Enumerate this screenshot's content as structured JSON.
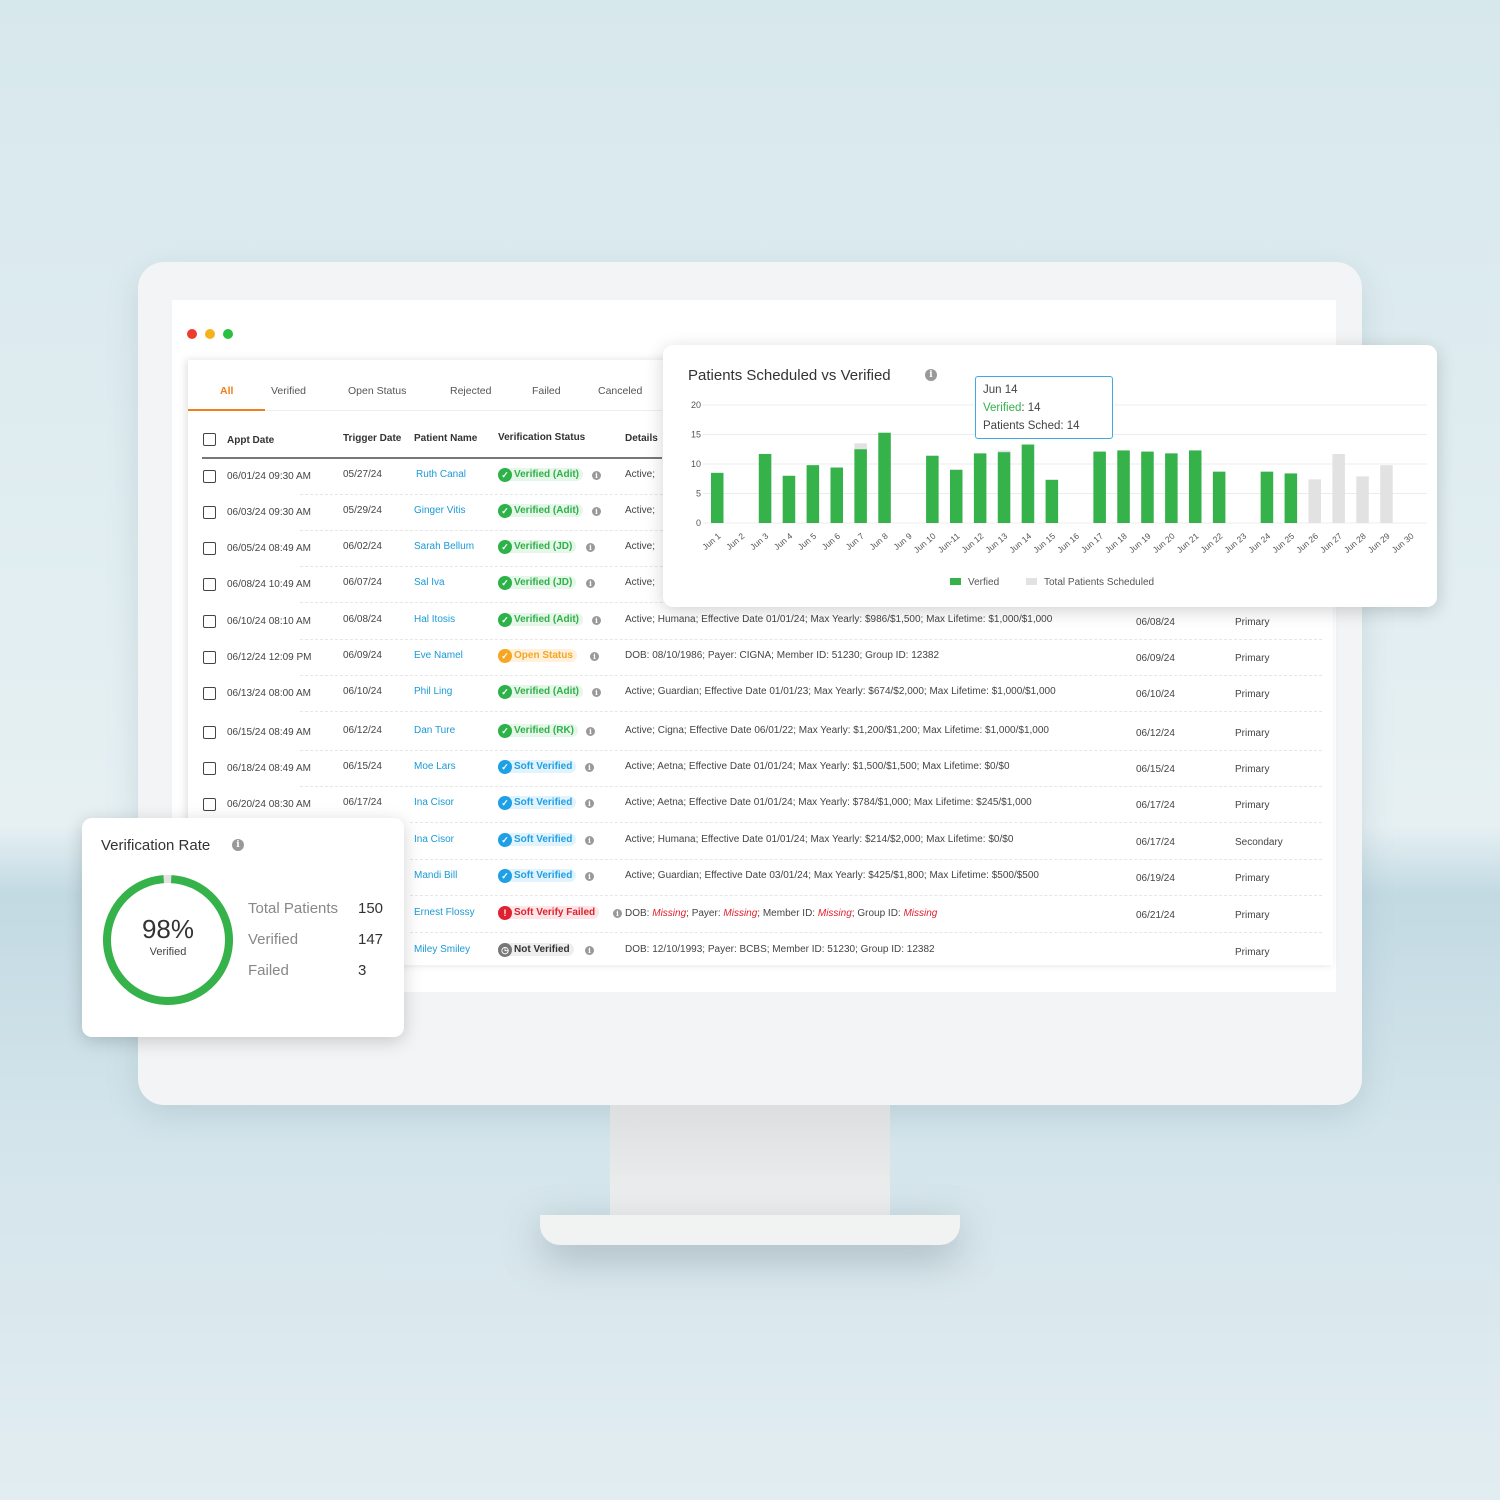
{
  "window": {
    "controls": [
      "close",
      "minimize",
      "maximize"
    ],
    "colors": {
      "close": "#ee3b2f",
      "minimize": "#f6b21b",
      "maximize": "#28c03d"
    }
  },
  "tabs": [
    {
      "label": "All",
      "active": true
    },
    {
      "label": "Verified"
    },
    {
      "label": "Open Status"
    },
    {
      "label": "Rejected"
    },
    {
      "label": "Failed"
    },
    {
      "label": "Canceled"
    }
  ],
  "table": {
    "headers": {
      "appt_date": "Appt Date",
      "trigger_date": "Trigger Date",
      "patient_name": "Patient Name",
      "status": "Verification Status",
      "details": "Details"
    },
    "rows": [
      {
        "appt": "06/01/24 09:30 AM",
        "trigger": "05/27/24",
        "name": "Ruth Canal",
        "status": "Verified (Adit)",
        "kind": "verified",
        "details": "Active;",
        "date": "",
        "type": ""
      },
      {
        "appt": "06/03/24 09:30 AM",
        "trigger": "05/29/24",
        "name": "Ginger Vitis",
        "status": "Verified (Adit)",
        "kind": "verified",
        "details": "Active;",
        "date": "",
        "type": ""
      },
      {
        "appt": "06/05/24 08:49 AM",
        "trigger": "06/02/24",
        "name": "Sarah Bellum",
        "status": "Verified (JD)",
        "kind": "verified",
        "details": "Active;",
        "date": "",
        "type": ""
      },
      {
        "appt": "06/08/24 10:49 AM",
        "trigger": "06/07/24",
        "name": "Sal Iva",
        "status": "Verified (JD)",
        "kind": "verified",
        "details": "Active;",
        "date": "",
        "type": ""
      },
      {
        "appt": "06/10/24 08:10 AM",
        "trigger": "06/08/24",
        "name": "Hal Itosis",
        "status": "Verified (Adit)",
        "kind": "verified",
        "details": "Active; Humana; Effective Date 01/01/24; Max Yearly: $986/$1,500; Max Lifetime: $1,000/$1,000",
        "date": "06/08/24",
        "type": "Primary"
      },
      {
        "appt": "06/12/24 12:09 PM",
        "trigger": "06/09/24",
        "name": "Eve Namel",
        "status": "Open Status",
        "kind": "open",
        "details": "DOB: 08/10/1986; Payer: CIGNA; Member ID: 51230; Group ID: 12382",
        "date": "06/09/24",
        "type": "Primary"
      },
      {
        "appt": "06/13/24 08:00 AM",
        "trigger": "06/10/24",
        "name": "Phil Ling",
        "status": "Verified (Adit)",
        "kind": "verified",
        "details": "Active; Guardian; Effective Date 01/01/23; Max Yearly: $674/$2,000; Max Lifetime: $1,000/$1,000",
        "date": "06/10/24",
        "type": "Primary"
      },
      {
        "appt": "06/15/24 08:49 AM",
        "trigger": "06/12/24",
        "name": "Dan Ture",
        "status": "Verified (RK)",
        "kind": "verified",
        "details": "Active; Cigna; Effective Date 06/01/22; Max Yearly: $1,200/$1,200; Max Lifetime: $1,000/$1,000",
        "date": "06/12/24",
        "type": "Primary"
      },
      {
        "appt": "06/18/24 08:49 AM",
        "trigger": "06/15/24",
        "name": "Moe Lars",
        "status": "Soft Verified",
        "kind": "soft",
        "details": "Active; Aetna; Effective Date 01/01/24; Max Yearly: $1,500/$1,500; Max Lifetime: $0/$0",
        "date": "06/15/24",
        "type": "Primary"
      },
      {
        "appt": "06/20/24 08:30 AM",
        "trigger": "06/17/24",
        "name": "Ina Cisor",
        "status": "Soft Verified",
        "kind": "soft",
        "details": "Active; Aetna; Effective Date 01/01/24; Max Yearly: $784/$1,000; Max Lifetime: $245/$1,000",
        "date": "06/17/24",
        "type": "Primary"
      },
      {
        "appt": "",
        "trigger": "",
        "name": "Ina Cisor",
        "status": "Soft Verified",
        "kind": "soft",
        "details": "Active; Humana; Effective Date 01/01/24; Max Yearly: $214/$2,000; Max Lifetime: $0/$0",
        "date": "06/17/24",
        "type": "Secondary"
      },
      {
        "appt": "",
        "trigger": "",
        "name": "Mandi Bill",
        "status": "Soft Verified",
        "kind": "soft",
        "details": "Active; Guardian; Effective Date 03/01/24; Max Yearly: $425/$1,800; Max Lifetime: $500/$500",
        "date": "06/19/24",
        "type": "Primary"
      },
      {
        "appt": "",
        "trigger": "",
        "name": "Ernest Flossy",
        "status": "Soft Verify Failed",
        "kind": "failed",
        "details_parts": [
          "DOB: ",
          "Missing",
          "; Payer: ",
          "Missing",
          "; Member ID: ",
          "Missing",
          "; Group ID: ",
          "Missing"
        ],
        "date": "06/21/24",
        "type": "Primary"
      },
      {
        "appt": "",
        "trigger": "",
        "name": "Miley Smiley",
        "status": "Not Verified",
        "kind": "not",
        "details": "DOB: 12/10/1993; Payer: BCBS; Member ID: 51230; Group ID: 12382",
        "date": "",
        "type": "Primary"
      }
    ]
  },
  "status_colors": {
    "verified": "#2db24a",
    "open": "#f5a623",
    "soft": "#1ea0e6",
    "failed": "#e0212f",
    "not": "#777777"
  },
  "chart_data": {
    "type": "bar",
    "title": "Patients Scheduled vs Verified",
    "categories": [
      "Jun 1",
      "Jun 2",
      "Jun 3",
      "Jun 4",
      "Jun 5",
      "Jun 6",
      "Jun 7",
      "Jun 8",
      "Jun 9",
      "Jun 10",
      "Jun-11",
      "Jun 12",
      "Jun 13",
      "Jun 14",
      "Jun 15",
      "Jun 16",
      "Jun 17",
      "Jun 18",
      "Jun 19",
      "Jun 20",
      "Jun 21",
      "Jun 22",
      "Jun 23",
      "Jun 24",
      "Jun 25",
      "Jun 26",
      "Jun 27",
      "Jun 28",
      "Jun 29",
      "Jun 30"
    ],
    "series": [
      {
        "name": "Verfied",
        "color": "#36b24a",
        "values": [
          8.5,
          0,
          11.7,
          8,
          9.8,
          9.4,
          12.5,
          15.3,
          0,
          11.4,
          9,
          11.8,
          12,
          13.3,
          7.3,
          0,
          12.1,
          12.3,
          12.1,
          11.8,
          12.3,
          8.7,
          0,
          8.7,
          8.4,
          0,
          0,
          0,
          0,
          0
        ]
      },
      {
        "name": "Total Patients Scheduled",
        "color": "#e2e2e2",
        "values": [
          8.5,
          0,
          11.7,
          8,
          9.8,
          9.4,
          13.5,
          15.3,
          0,
          11.4,
          9.1,
          11.8,
          12.3,
          13.3,
          7.4,
          0,
          12.1,
          12.3,
          12.1,
          11.8,
          12.3,
          8.7,
          0,
          8.7,
          8.4,
          7.4,
          11.7,
          7.9,
          9.8,
          0
        ]
      }
    ],
    "ylim": [
      0,
      20
    ],
    "yticks": [
      "0",
      "5",
      "10",
      "15",
      "20"
    ],
    "grid": true,
    "legend": "bottom",
    "tooltip": {
      "title": "Jun 14",
      "verified_label": "Verified",
      "verified_value": ": 14",
      "sched": "Patients Sched: 14"
    }
  },
  "rate": {
    "title": "Verification Rate",
    "percent": "98%",
    "percent_value": 98,
    "sub": "Verified",
    "stats": [
      {
        "label": "Total Patients",
        "value": "150"
      },
      {
        "label": "Verified",
        "value": "147"
      },
      {
        "label": "Failed",
        "value": "3"
      }
    ]
  }
}
